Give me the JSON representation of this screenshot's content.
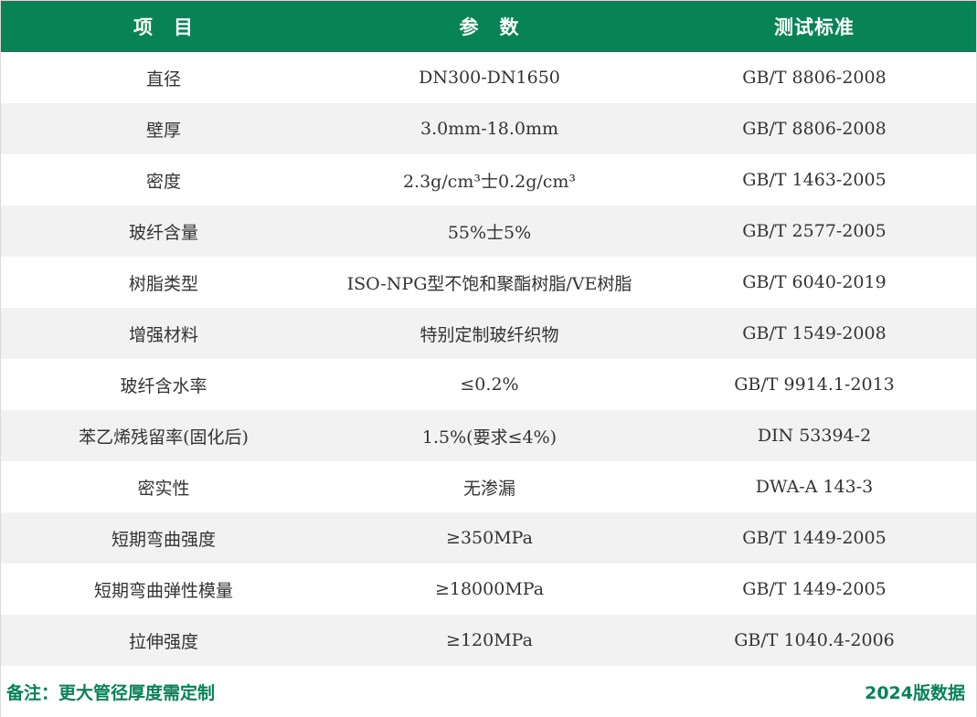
{
  "table": {
    "headers": [
      "项　目",
      "参　数",
      "测试标准"
    ],
    "rows": [
      [
        "直径",
        "DN300-DN1650",
        "GB/T 8806-2008"
      ],
      [
        "壁厚",
        "3.0mm-18.0mm",
        "GB/T 8806-2008"
      ],
      [
        "密度",
        "2.3g/cm³士0.2g/cm³",
        "GB/T 1463-2005"
      ],
      [
        "玻纤含量",
        "55%士5%",
        "GB/T 2577-2005"
      ],
      [
        "树脂类型",
        "ISO-NPG型不饱和聚酯树脂/VE树脂",
        "GB/T 6040-2019"
      ],
      [
        "增强材料",
        "特别定制玻纤织物",
        "GB/T 1549-2008"
      ],
      [
        "玻纤含水率",
        "≤0.2%",
        "GB/T 9914.1-2013"
      ],
      [
        "苯乙烯残留率(固化后)",
        "1.5%(要求≤4%)",
        "DIN 53394-2"
      ],
      [
        "密实性",
        "无渗漏",
        "DWA-A 143-3"
      ],
      [
        "短期弯曲强度",
        "≥350MPa",
        "GB/T 1449-2005"
      ],
      [
        "短期弯曲弹性模量",
        "≥18000MPa",
        "GB/T 1449-2005"
      ],
      [
        "拉伸强度",
        "≥120MPa",
        "GB/T 1040.4-2006"
      ]
    ]
  },
  "footer": {
    "note": "备注：更大管径厚度需定制",
    "version": "2024版数据"
  },
  "colors": {
    "header_bg": "#078356",
    "accent_text": "#078356",
    "stripe_bg": "#f2f2f2"
  }
}
